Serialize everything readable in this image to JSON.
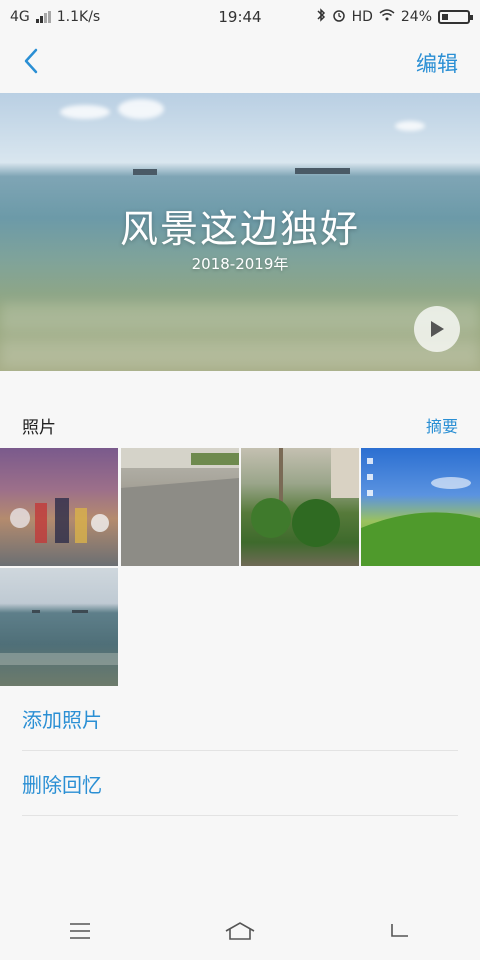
{
  "status_bar": {
    "network": "4G",
    "speed": "1.1K/s",
    "time": "19:44",
    "hd": "HD",
    "battery": "24%",
    "battery_level": 0.24
  },
  "nav": {
    "back_icon": "chevron-left-icon",
    "edit_label": "编辑"
  },
  "hero": {
    "title": "风景这边独好",
    "subtitle": "2018-2019年",
    "play_icon": "play-icon"
  },
  "photos": {
    "section_title": "照片",
    "summary_label": "摘要",
    "items": [
      {
        "name": "photo-game-characters"
      },
      {
        "name": "photo-street"
      },
      {
        "name": "photo-shrubs"
      },
      {
        "name": "photo-windows-xp-desktop"
      },
      {
        "name": "photo-sea"
      }
    ]
  },
  "actions": {
    "add_photos": "添加照片",
    "delete_memory": "删除回忆"
  },
  "bottom_nav": {
    "menu_icon": "menu-icon",
    "home_icon": "home-icon",
    "back_icon": "back-icon"
  },
  "colors": {
    "accent": "#2a8fd4",
    "background": "#f7f7f7"
  }
}
